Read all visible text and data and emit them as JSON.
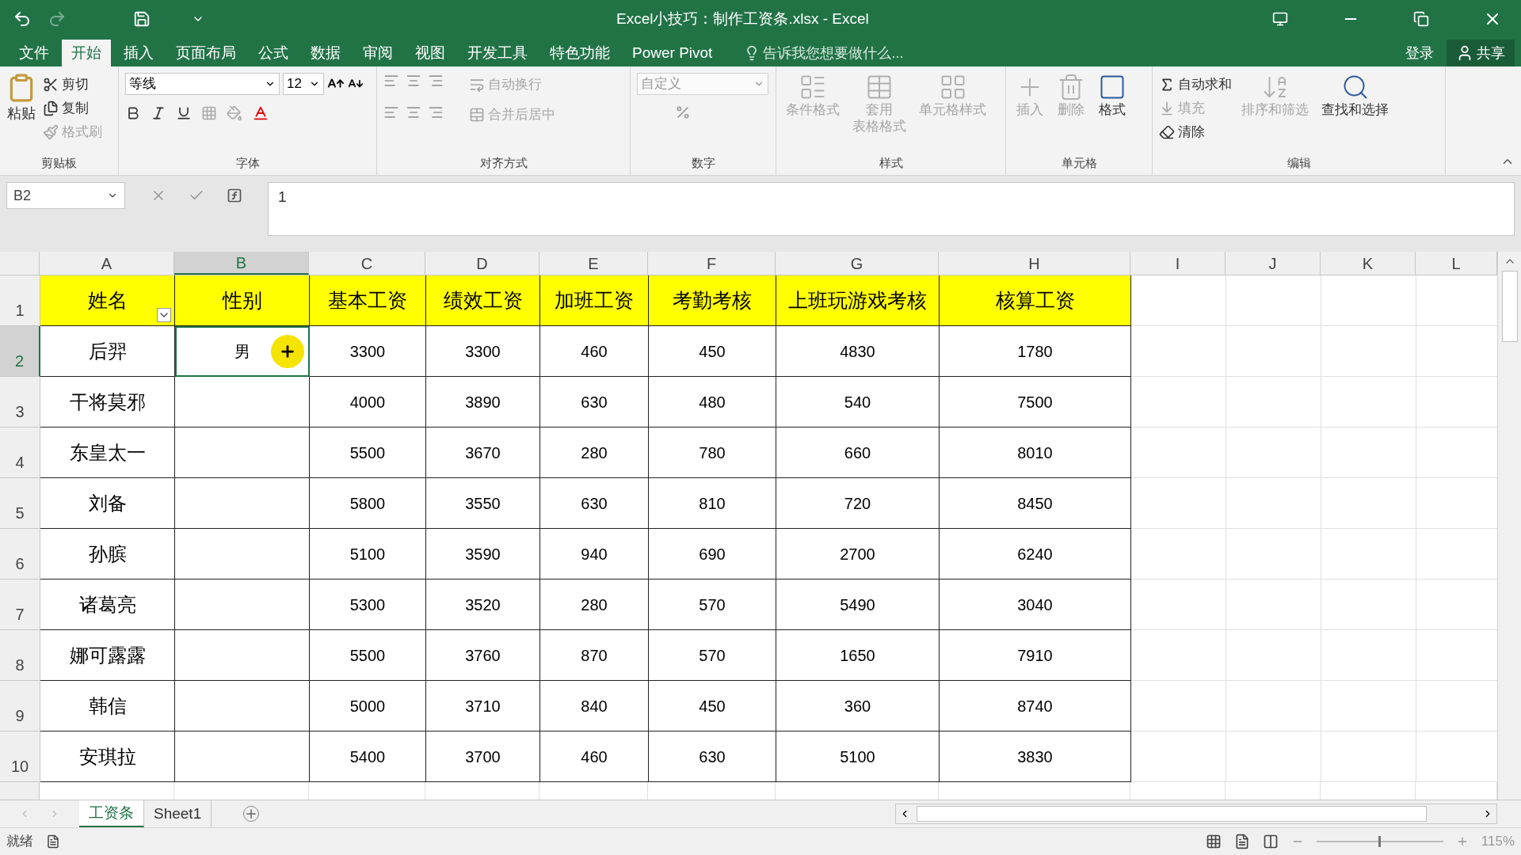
{
  "window": {
    "title": "Excel小技巧：制作工资条.xlsx - Excel"
  },
  "menu_tabs": [
    {
      "label": "文件",
      "selected": false
    },
    {
      "label": "开始",
      "selected": true
    },
    {
      "label": "插入",
      "selected": false
    },
    {
      "label": "页面布局",
      "selected": false
    },
    {
      "label": "公式",
      "selected": false
    },
    {
      "label": "数据",
      "selected": false
    },
    {
      "label": "审阅",
      "selected": false
    },
    {
      "label": "视图",
      "selected": false
    },
    {
      "label": "开发工具",
      "selected": false
    },
    {
      "label": "特色功能",
      "selected": false
    },
    {
      "label": "Power Pivot",
      "selected": false
    }
  ],
  "tell_me": {
    "placeholder": "告诉我您想要做什么..."
  },
  "account": {
    "login": "登录",
    "share": "共享"
  },
  "ribbon": {
    "clipboard": {
      "label": "剪贴板",
      "paste": "粘贴",
      "items": [
        {
          "label": "剪切",
          "disabled": false
        },
        {
          "label": "复制",
          "disabled": false
        },
        {
          "label": "格式刷",
          "disabled": true
        }
      ]
    },
    "font": {
      "label": "字体",
      "font_name": "等线",
      "font_size": "12"
    },
    "alignment": {
      "label": "对齐方式",
      "wrap": "自动换行",
      "merge": "合并后居中"
    },
    "number": {
      "label": "数字",
      "format": "自定义"
    },
    "styles": {
      "label": "样式",
      "items": [
        {
          "lines": [
            "条件格式"
          ],
          "disabled": true
        },
        {
          "lines": [
            "套用",
            "表格格式"
          ],
          "disabled": true
        },
        {
          "lines": [
            "单元格样式"
          ],
          "disabled": true
        }
      ]
    },
    "cells": {
      "label": "单元格",
      "items": [
        {
          "lines": [
            "插入"
          ],
          "disabled": true
        },
        {
          "lines": [
            "删除"
          ],
          "disabled": true
        },
        {
          "lines": [
            "格式"
          ],
          "disabled": false
        }
      ]
    },
    "editing": {
      "label": "编辑",
      "small": [
        {
          "label": "自动求和",
          "disabled": false
        },
        {
          "label": "填充",
          "disabled": true
        },
        {
          "label": "清除",
          "disabled": false
        }
      ],
      "large": [
        {
          "lines": [
            "排序和筛选"
          ],
          "disabled": true
        },
        {
          "lines": [
            "查找和选择"
          ],
          "disabled": false
        }
      ]
    }
  },
  "formula_bar": {
    "name_box": "B2",
    "value": "1"
  },
  "sheet": {
    "columns": [
      {
        "label": "A",
        "selected": false
      },
      {
        "label": "B",
        "selected": true
      },
      {
        "label": "C",
        "selected": false
      },
      {
        "label": "D",
        "selected": false
      },
      {
        "label": "E",
        "selected": false
      },
      {
        "label": "F",
        "selected": false
      },
      {
        "label": "G",
        "selected": false
      },
      {
        "label": "H",
        "selected": false
      },
      {
        "label": "I",
        "selected": false
      },
      {
        "label": "J",
        "selected": false
      },
      {
        "label": "K",
        "selected": false
      },
      {
        "label": "L",
        "selected": false
      }
    ],
    "rows": [
      {
        "number": "1",
        "kind": "header",
        "selected": false,
        "filter": true,
        "cells": [
          "姓名",
          "性别",
          "基本工资",
          "绩效工资",
          "加班工资",
          "考勤考核",
          "上班玩游戏考核",
          "核算工资"
        ]
      },
      {
        "number": "2",
        "kind": "data",
        "selected": true,
        "cells": [
          "后羿",
          "男",
          "3300",
          "3300",
          "460",
          "450",
          "4830",
          "1780"
        ]
      },
      {
        "number": "3",
        "kind": "data",
        "selected": false,
        "cells": [
          "干将莫邪",
          "",
          "4000",
          "3890",
          "630",
          "480",
          "540",
          "7500"
        ]
      },
      {
        "number": "4",
        "kind": "data",
        "selected": false,
        "cells": [
          "东皇太一",
          "",
          "5500",
          "3670",
          "280",
          "780",
          "660",
          "8010"
        ]
      },
      {
        "number": "5",
        "kind": "data",
        "selected": false,
        "cells": [
          "刘备",
          "",
          "5800",
          "3550",
          "630",
          "810",
          "720",
          "8450"
        ]
      },
      {
        "number": "6",
        "kind": "data",
        "selected": false,
        "cells": [
          "孙膑",
          "",
          "5100",
          "3590",
          "940",
          "690",
          "2700",
          "6240"
        ]
      },
      {
        "number": "7",
        "kind": "data",
        "selected": false,
        "cells": [
          "诸葛亮",
          "",
          "5300",
          "3520",
          "280",
          "570",
          "5490",
          "3040"
        ]
      },
      {
        "number": "8",
        "kind": "data",
        "selected": false,
        "cells": [
          "娜可露露",
          "",
          "5500",
          "3760",
          "870",
          "570",
          "1650",
          "7910"
        ]
      },
      {
        "number": "9",
        "kind": "data",
        "selected": false,
        "cells": [
          "韩信",
          "",
          "5000",
          "3710",
          "840",
          "450",
          "360",
          "8740"
        ]
      },
      {
        "number": "10",
        "kind": "data",
        "selected": false,
        "cells": [
          "安琪拉",
          "",
          "5400",
          "3700",
          "460",
          "630",
          "5100",
          "3830"
        ]
      }
    ]
  },
  "sheet_tabs": [
    {
      "label": "工资条",
      "selected": true
    },
    {
      "label": "Sheet1",
      "selected": false
    }
  ],
  "status_bar": {
    "status": "就绪",
    "zoom": "115%",
    "zoom_slider": {
      "level": 0.5
    }
  }
}
